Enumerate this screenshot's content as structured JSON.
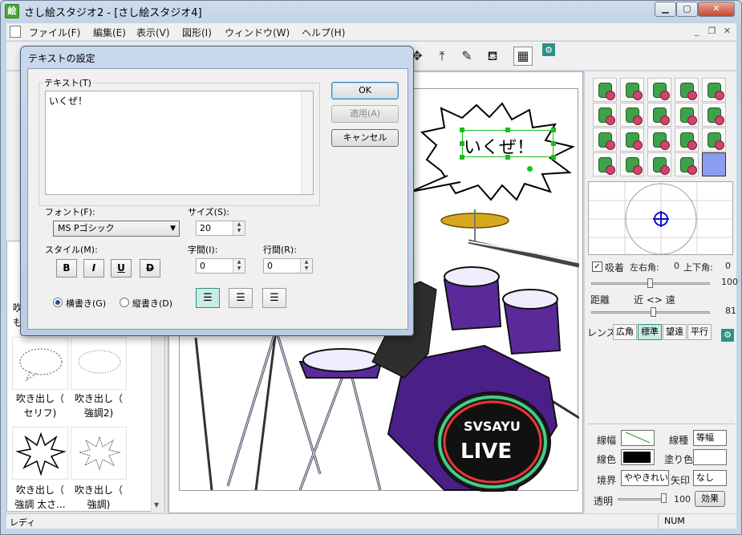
{
  "window": {
    "title": "さし絵スタジオ2 - [さし絵スタジオ4]",
    "app_icon_glyph": "絵"
  },
  "menu": [
    "ファイル(F)",
    "編集(E)",
    "表示(V)",
    "図形(I)",
    "ウィンドウ(W)",
    "ヘルプ(H)"
  ],
  "toolbar_icons": [
    "pan-icon",
    "move-up-icon",
    "eyedropper-icon",
    "paint-bucket-icon",
    "render-image-icon",
    "settings-icon"
  ],
  "left_panel": {
    "thumbnails": [
      {
        "label_lines": [
          "吹き出し（",
          "セリフ)"
        ]
      },
      {
        "label_lines": [
          "吹き出し（",
          "強調2)"
        ]
      },
      {
        "label_lines": [
          "吹き出し（",
          "強調 太さ..."
        ]
      },
      {
        "label_lines": [
          "吹き出し（",
          "強調)"
        ]
      }
    ],
    "partial_text": [
      "吹き",
      "も"
    ]
  },
  "canvas": {
    "speech_text": "いくぜ！"
  },
  "right_panel": {
    "attach_label": "吸着",
    "lr_angle_label": "左右角:",
    "lr_angle_value": "0",
    "ud_angle_label": "上下角:",
    "ud_angle_value": "0",
    "value_100": "100",
    "distance_label": "距離",
    "near_far": "近 <> 遠",
    "distance_value": "81",
    "lens_label": "レンズ",
    "lens_options": [
      "広角",
      "標準",
      "望遠",
      "平行"
    ],
    "lens_selected": "標準",
    "line_width_label": "線幅",
    "line_type_label": "線種",
    "line_type_value": "等幅",
    "line_color_label": "線色",
    "fill_color_label": "塗り色",
    "border_label": "境界",
    "border_value": "ややきれい",
    "arrow_label": "矢印",
    "arrow_value": "なし",
    "transparency_label": "透明",
    "transparency_value": "100",
    "effect_button": "効果"
  },
  "status": {
    "left": "レディ",
    "num": "NUM"
  },
  "dialog": {
    "title": "テキストの設定",
    "text_label": "テキスト(T)",
    "text_value": "いくぜ！",
    "ok": "OK",
    "apply": "適用(A)",
    "cancel": "キャンセル",
    "font_label": "フォント(F):",
    "font_value": "MS Pゴシック",
    "size_label": "サイズ(S):",
    "size_value": "20",
    "style_label": "スタイル(M):",
    "char_spacing_label": "字間(I):",
    "char_spacing_value": "0",
    "line_spacing_label": "行間(R):",
    "line_spacing_value": "0",
    "style_buttons": [
      "B",
      "I",
      "U",
      "D"
    ],
    "horizontal_label": "横書き(G)",
    "vertical_label": "縦書き(D)",
    "orientation_selected": "横書き(G)"
  },
  "colors": {
    "accent_teal": "#2f8f8a",
    "material_green": "#3fa24a",
    "material_pink": "#d2436b",
    "drum_purple": "#5a2a9a",
    "cymbal_gold": "#d7a81d",
    "selection_green": "#18c018",
    "fill_swatch": "#8c9cf0"
  }
}
